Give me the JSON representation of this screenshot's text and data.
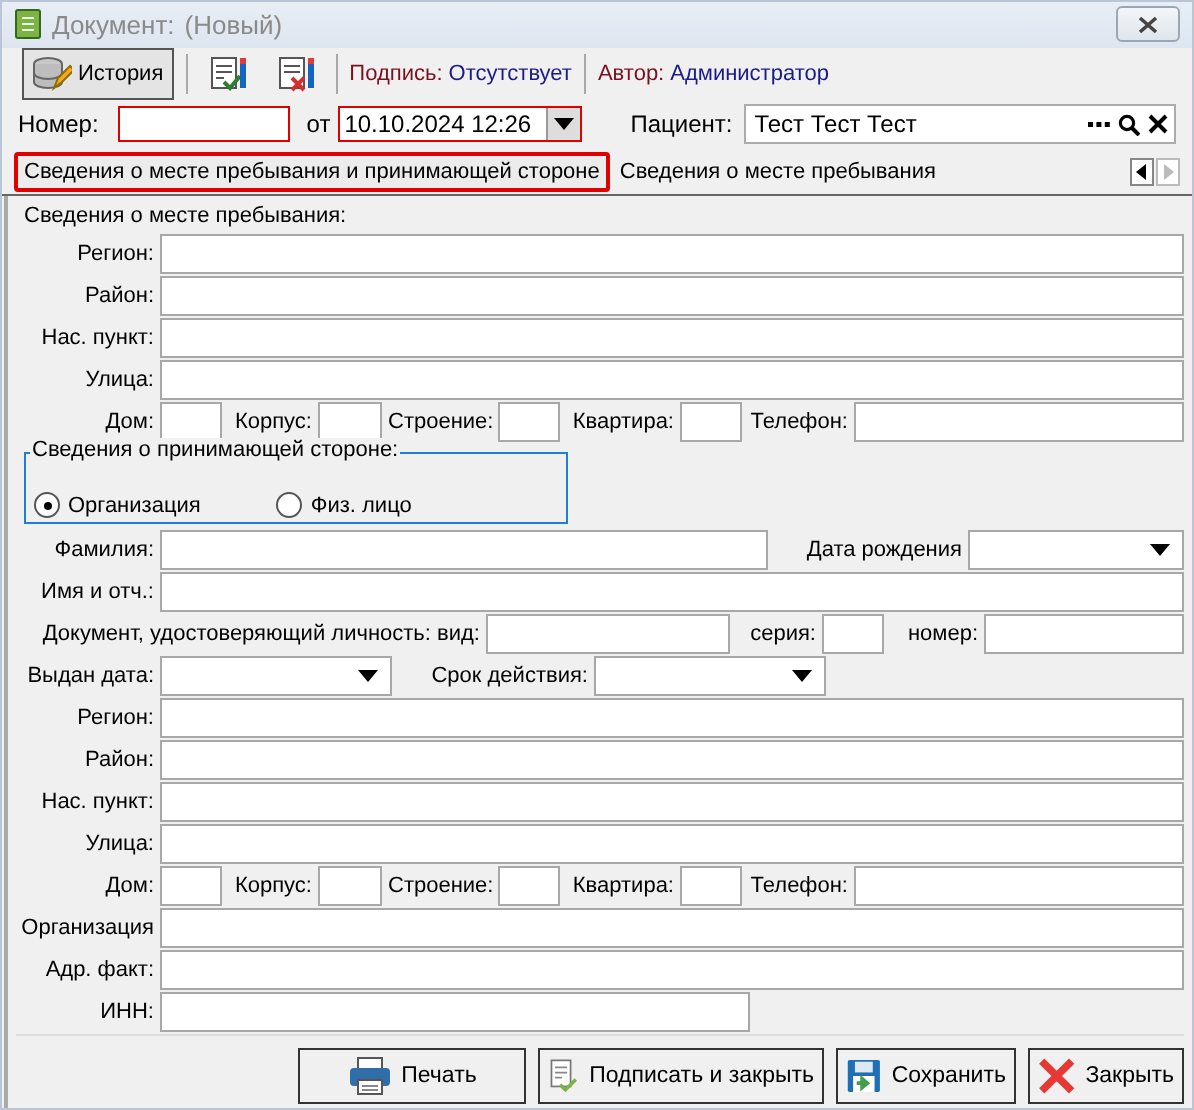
{
  "window": {
    "title": "Документ:",
    "subtitle": "(Новый)"
  },
  "toolbar": {
    "history_button": "История",
    "signature_label": "Подпись:",
    "signature_value": "Отсутствует",
    "author_label": "Автор:",
    "author_value": "Администратор"
  },
  "header": {
    "number_label": "Номер:",
    "number": {
      "required": true
    },
    "from_label": "от",
    "date": {
      "value": "10.10.2024 12:26",
      "required": true
    },
    "patient_label": "Пациент:",
    "patient": "Тест Тест Тест"
  },
  "tabs": [
    {
      "label": "Сведения о месте пребывания и принимающей стороне",
      "selected": true
    },
    {
      "label": "Сведения о месте пребывания",
      "selected": false
    }
  ],
  "stay": {
    "title": "Сведения о месте пребывания:",
    "fields": [
      "Регион:",
      "Район:",
      "Нас. пункт:",
      "Улица:"
    ],
    "address_row": [
      "Дом:",
      "Корпус:",
      "Строение:",
      "Квартира:",
      "Телефон:"
    ]
  },
  "host": {
    "title": "Сведения о принимающей стороне:",
    "options": [
      {
        "label": "Организация",
        "selected": true
      },
      {
        "label": "Физ. лицо",
        "selected": false
      }
    ]
  },
  "person": {
    "surname_label": "Фамилия:",
    "birth_date_label": "Дата рождения",
    "name_label": "Имя и отч.:",
    "document_label": "Документ, удостоверяющий личность: вид:",
    "series_label": "серия:",
    "number_label": "номер:",
    "issued_label": "Выдан дата:",
    "validity_label": "Срок действия:",
    "fields": [
      "Регион:",
      "Район:",
      "Нас. пункт:",
      "Улица:"
    ],
    "address_row": [
      "Дом:",
      "Корпус:",
      "Строение:",
      "Квартира:",
      "Телефон:"
    ],
    "organization_label": "Организация",
    "actual_address_label": "Адр. факт:",
    "inn_label": "ИНН:"
  },
  "buttons": [
    {
      "label": "Печать",
      "kind": "print"
    },
    {
      "label": "Подписать и закрыть",
      "kind": "sign"
    },
    {
      "label": "Сохранить",
      "kind": "save"
    },
    {
      "label": "Закрыть",
      "kind": "close"
    }
  ]
}
